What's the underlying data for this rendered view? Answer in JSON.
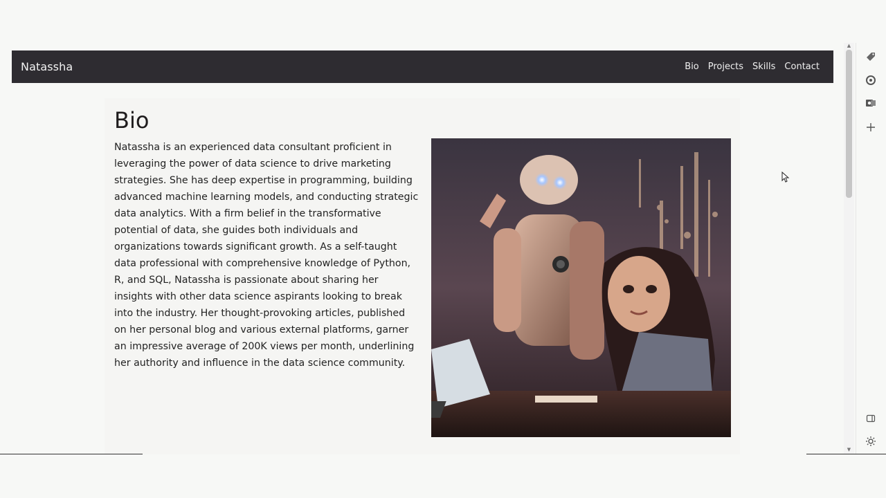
{
  "navbar": {
    "brand": "Natassha",
    "links": [
      "Bio",
      "Projects",
      "Skills",
      "Contact"
    ]
  },
  "bio": {
    "title": "Bio",
    "text": "Natassha is an experienced data consultant proficient in leveraging the power of data science to drive marketing strategies. She has deep expertise in programming, building advanced machine learning models, and conducting strategic data analytics. With a firm belief in the transformative potential of data, she guides both individuals and organizations towards significant growth. As a self-taught data professional with comprehensive knowledge of Python, R, and SQL, Natassha is passionate about sharing her insights with other data science aspirants looking to break into the industry. Her thought-provoking articles, published on her personal blog and various external platforms, garner an impressive average of 200K views per month, underlining her authority and influence in the data science community.",
    "image_alt": "robot-and-woman-illustration"
  },
  "sidebar": {
    "icons": [
      "tag-icon",
      "copilot-icon",
      "outlook-icon",
      "plus-icon",
      "panel-icon",
      "settings-icon"
    ]
  },
  "colors": {
    "navbar_bg": "#2e2c31",
    "page_bg": "#f7f8f6"
  }
}
